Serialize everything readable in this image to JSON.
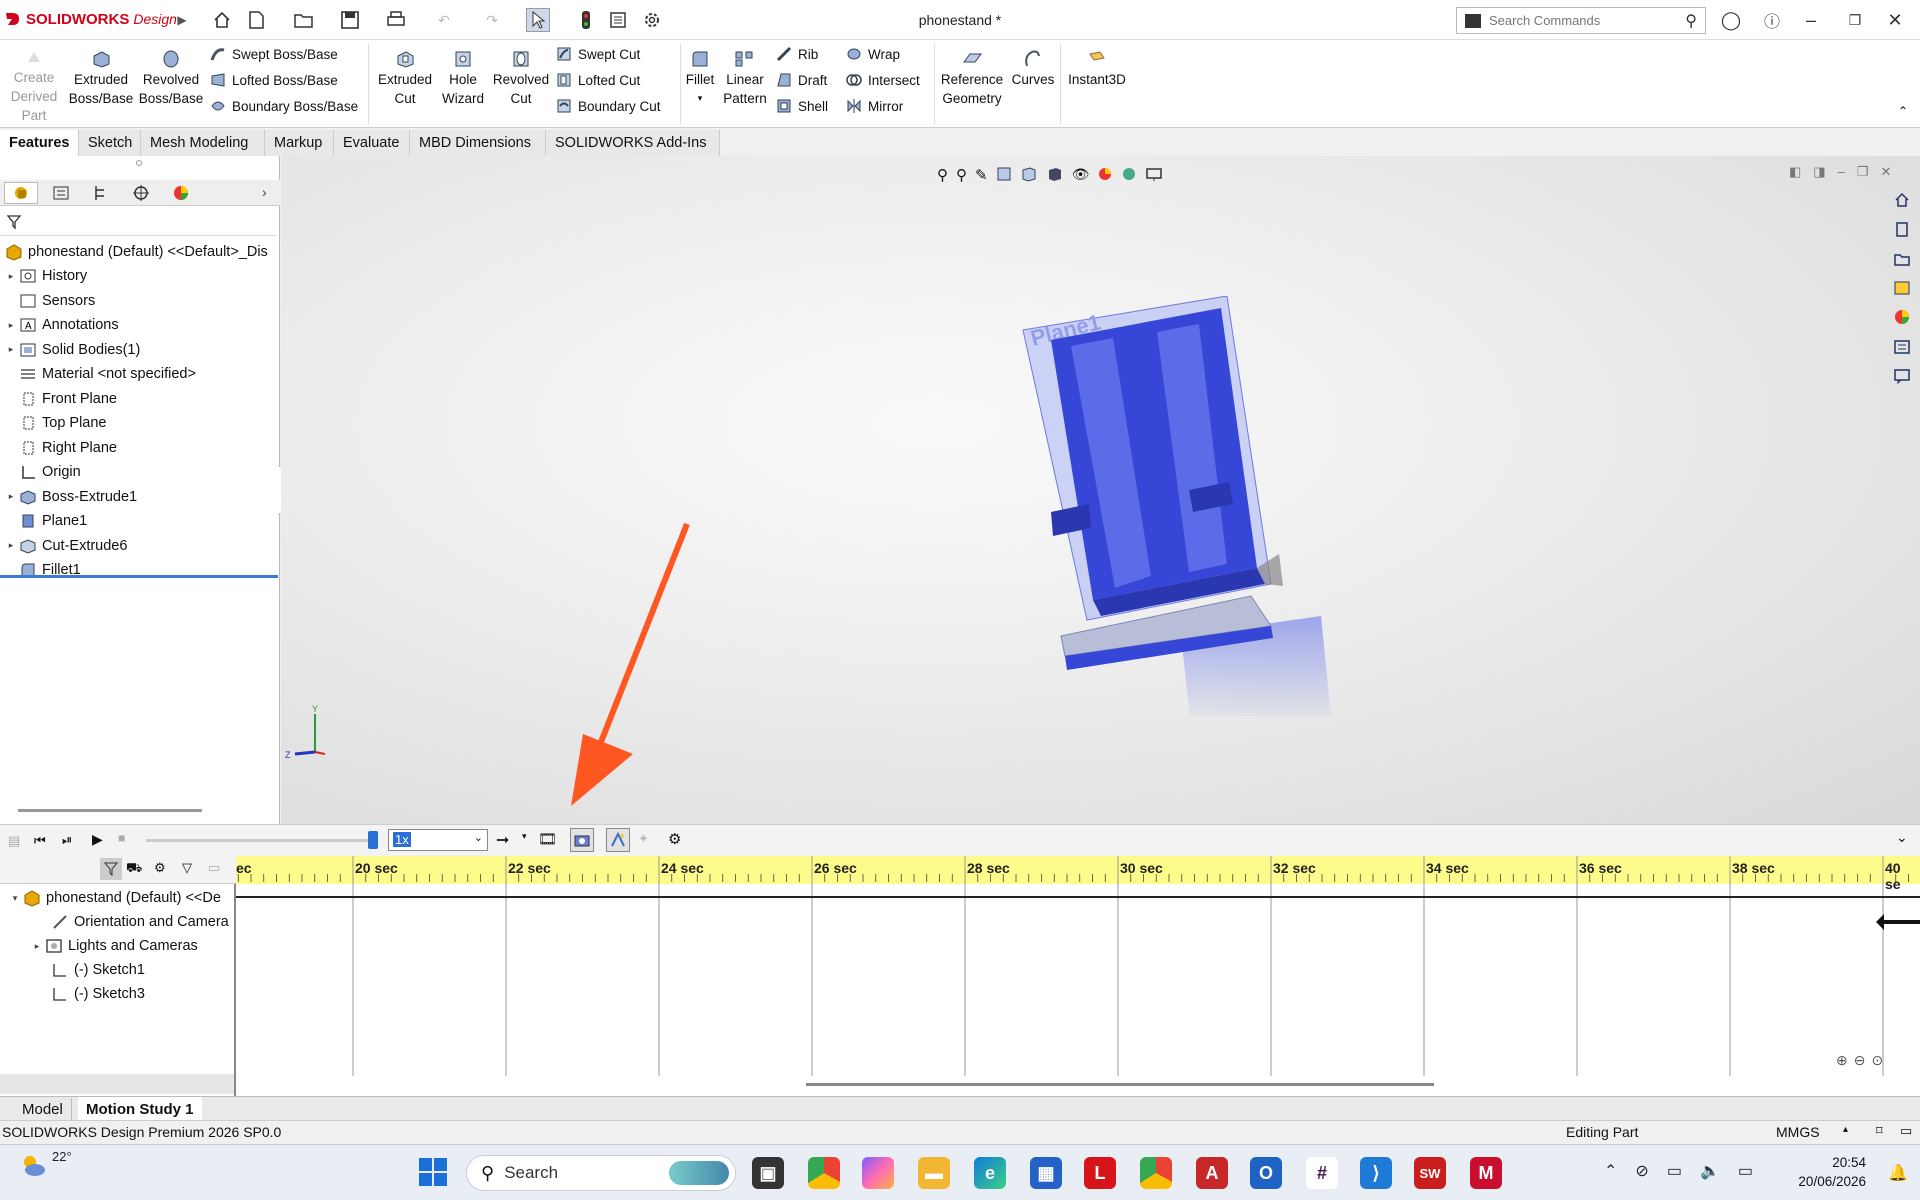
{
  "app": {
    "brand": "SOLIDWORKS",
    "brand_sub": "Design",
    "doc_title": "phonestand *",
    "search_placeholder": "Search Commands"
  },
  "ribbon": {
    "create_derived": [
      "Create",
      "Derived",
      "Part"
    ],
    "extruded_boss": [
      "Extruded",
      "Boss/Base"
    ],
    "revolved_boss": [
      "Revolved",
      "Boss/Base"
    ],
    "swept_boss": "Swept Boss/Base",
    "lofted_boss": "Lofted Boss/Base",
    "boundary_boss": "Boundary Boss/Base",
    "extruded_cut": [
      "Extruded",
      "Cut"
    ],
    "hole_wizard": [
      "Hole",
      "Wizard"
    ],
    "revolved_cut": [
      "Revolved",
      "Cut"
    ],
    "swept_cut": "Swept Cut",
    "lofted_cut": "Lofted Cut",
    "boundary_cut": "Boundary Cut",
    "fillet": "Fillet",
    "linear_pattern": [
      "Linear",
      "Pattern"
    ],
    "rib": "Rib",
    "draft": "Draft",
    "shell": "Shell",
    "wrap": "Wrap",
    "intersect": "Intersect",
    "mirror": "Mirror",
    "reference_geometry": [
      "Reference",
      "Geometry"
    ],
    "curves": "Curves",
    "instant3d": "Instant3D"
  },
  "tabs": [
    "Features",
    "Sketch",
    "Mesh Modeling",
    "Markup",
    "Evaluate",
    "MBD Dimensions",
    "SOLIDWORKS Add-Ins"
  ],
  "feature_tree": {
    "root": "phonestand (Default) <<Default>_Dis",
    "items": [
      {
        "label": "History",
        "expand": true
      },
      {
        "label": "Sensors",
        "expand": false
      },
      {
        "label": "Annotations",
        "expand": true
      },
      {
        "label": "Solid Bodies(1)",
        "expand": true
      },
      {
        "label": "Material <not specified>",
        "expand": false
      },
      {
        "label": "Front Plane",
        "expand": false
      },
      {
        "label": "Top Plane",
        "expand": false
      },
      {
        "label": "Right Plane",
        "expand": false
      },
      {
        "label": "Origin",
        "expand": false
      },
      {
        "label": "Boss-Extrude1",
        "expand": true
      },
      {
        "label": "Plane1",
        "expand": false
      },
      {
        "label": "Cut-Extrude6",
        "expand": true
      },
      {
        "label": "Fillet1",
        "expand": false
      }
    ]
  },
  "viewport": {
    "plane_label": "Plane1",
    "triad_y": "Y",
    "triad_z": "Z"
  },
  "motion": {
    "speed": "1x",
    "tree_root": "phonestand (Default) <<De",
    "tree_items": [
      "Orientation and Camera",
      "Lights and Cameras",
      "(-) Sketch1",
      "(-) Sketch3"
    ],
    "timeline_ticks": [
      "ec",
      "20 sec",
      "22 sec",
      "24 sec",
      "26 sec",
      "28 sec",
      "30 sec",
      "32 sec",
      "34 sec",
      "36 sec",
      "38 sec",
      "40 se"
    ]
  },
  "bottom_tabs": [
    "Model",
    "Motion Study 1"
  ],
  "status": {
    "product": "SOLIDWORKS Design Premium 2026 SP0.0",
    "mode": "Editing Part",
    "units": "MMGS"
  },
  "taskbar": {
    "weather": "22°",
    "search": "Search",
    "time": "20:54",
    "date": "20/06/2026"
  },
  "colors": {
    "annotation_arrow": "#ff5722",
    "model_blue": "#3a4fd8",
    "timeline_ruler": "#fdfb8a"
  }
}
